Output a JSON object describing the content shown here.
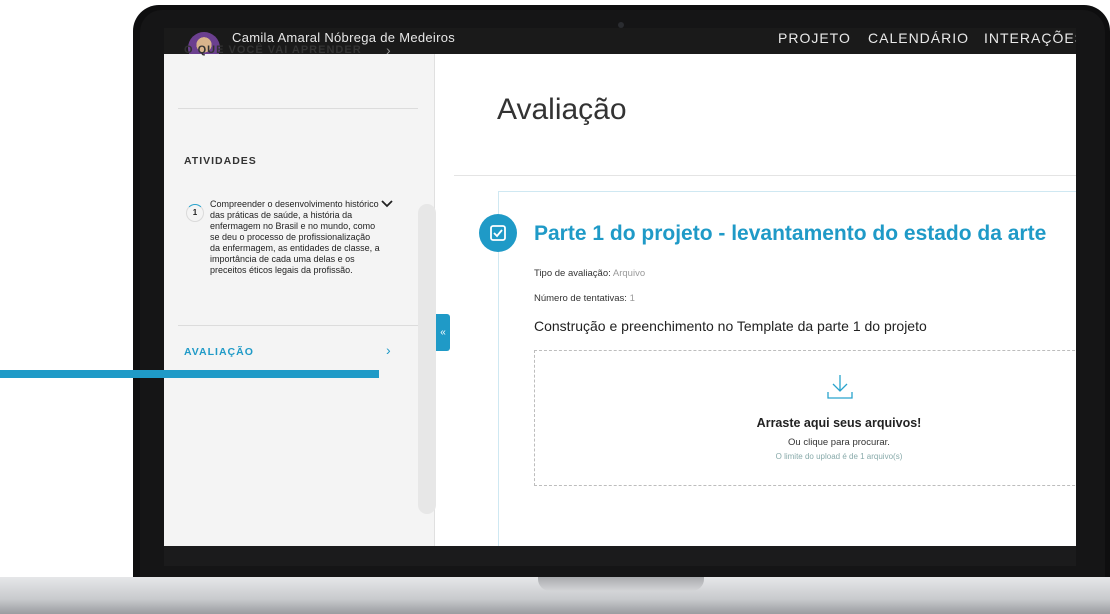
{
  "topbar": {
    "username": "Camila Amaral Nóbrega de Medeiros",
    "nav": [
      "PROJETO",
      "CALENDÁRIO",
      "INTERAÇÕES"
    ]
  },
  "sidebar": {
    "learn_label": "O QUE VOCÊ VAI APRENDER",
    "activities_title": "ATIVIDADES",
    "activity": {
      "number": "1",
      "text": "Compreender o desenvolvimento histórico das práticas de saúde, a história da enfermagem no Brasil e no mundo, como se deu o processo de profissionalização da enfermagem, as entidades de classe, a importância de cada uma delas e os preceitos éticos legais da profissão."
    },
    "evaluation_label": "AVALIAÇÃO",
    "collapse_symbol": "«"
  },
  "main": {
    "title": "Avaliação",
    "card": {
      "title": "Parte 1 do projeto - levantamento do estado da arte",
      "type_label": "Tipo de avaliação:",
      "type_value": "Arquivo",
      "attempts_label": "Número de tentativas:",
      "attempts_value": "1",
      "description": "Construção e preenchimento no Template da parte 1 do projeto",
      "dropzone": {
        "main": "Arraste aqui seus arquivos!",
        "sub": "Ou clique para procurar.",
        "limit": "O limite do upload é de 1 arquivo(s)"
      }
    }
  },
  "colors": {
    "accent": "#1f9ac7",
    "sidebar_bg": "#f4f4f4",
    "topbar_bg": "#1a1a1a"
  },
  "icons": [
    "chevron-down-icon",
    "chevron-right-icon",
    "checkbox-icon",
    "download-icon",
    "collapse-icon"
  ]
}
